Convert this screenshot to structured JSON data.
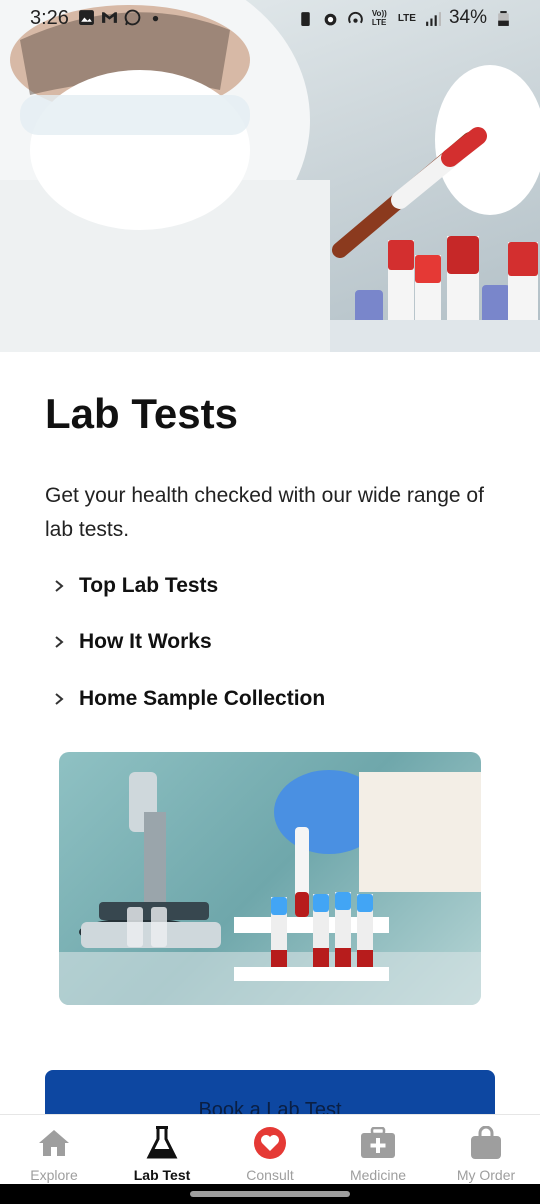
{
  "status_bar": {
    "time": "3:26",
    "battery_text": "34%",
    "network_labels": [
      "Vo)) LTE",
      "LTE"
    ]
  },
  "page": {
    "title": "Lab Tests",
    "description": "Get your health checked with our wide range of lab tests."
  },
  "accordions": [
    {
      "label": "Top Lab Tests",
      "icon": "chevron-right-icon"
    },
    {
      "label": "How It Works",
      "icon": "chevron-right-icon"
    },
    {
      "label": "Home Sample Collection",
      "icon": "chevron-right-icon"
    }
  ],
  "cta": {
    "label": "Book a Lab Test",
    "color": "#0d47a1"
  },
  "bottom_nav": [
    {
      "label": "Explore",
      "icon": "home-icon",
      "active": false
    },
    {
      "label": "Lab Test",
      "icon": "flask-icon",
      "active": true
    },
    {
      "label": "Consult",
      "icon": "heart-icon",
      "active": false
    },
    {
      "label": "Medicine",
      "icon": "medical-kit-icon",
      "active": false
    },
    {
      "label": "My Order",
      "icon": "shopping-bag-icon",
      "active": false
    }
  ],
  "colors": {
    "accent_red": "#e53935",
    "primary_blue": "#0d47a1",
    "inactive_gray": "#9e9e9e"
  }
}
